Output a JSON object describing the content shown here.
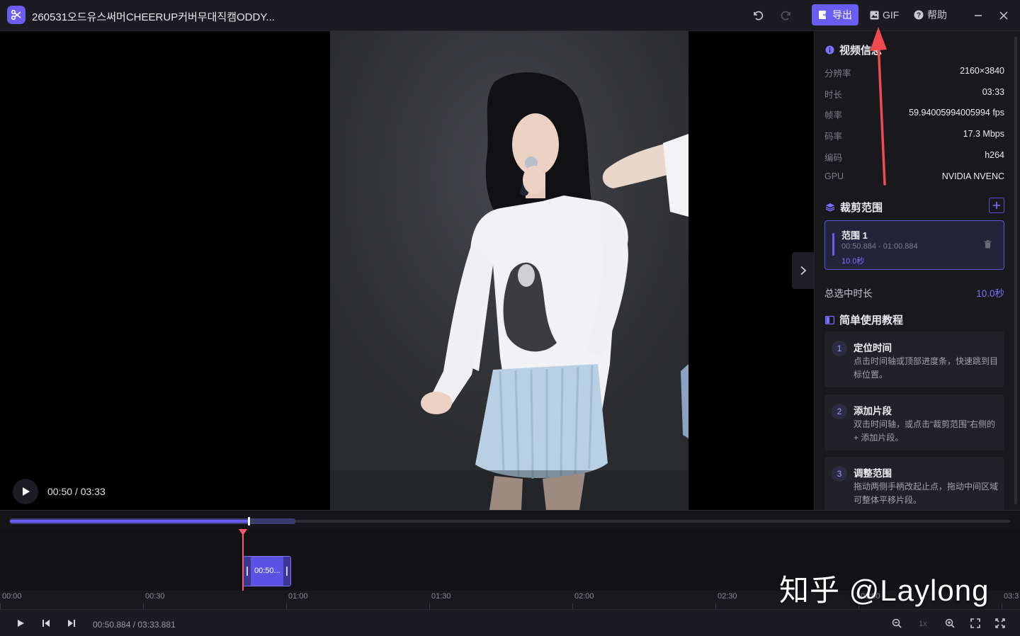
{
  "window": {
    "title": "260531오드유스써머CHEERUP커버무대직캠ODDY..."
  },
  "toolbar": {
    "export_label": "导出",
    "gif_label": "GIF",
    "help_label": "帮助"
  },
  "player": {
    "time_display": "00:50 / 03:33"
  },
  "video_info": {
    "title": "视频信息",
    "rows": [
      {
        "key": "分辨率",
        "value": "2160×3840"
      },
      {
        "key": "时长",
        "value": "03:33"
      },
      {
        "key": "帧率",
        "value": "59.94005994005994 fps"
      },
      {
        "key": "码率",
        "value": "17.3 Mbps"
      },
      {
        "key": "编码",
        "value": "h264"
      },
      {
        "key": "GPU",
        "value": "NVIDIA NVENC"
      }
    ]
  },
  "clip_ranges": {
    "title": "裁剪范围",
    "items": [
      {
        "name": "范围 1",
        "time": "00:50.884 - 01:00.884",
        "duration": "10.0秒"
      }
    ],
    "total_label": "总选中时长",
    "total_value": "10.0秒"
  },
  "tutorial": {
    "title": "简单使用教程",
    "steps": [
      {
        "num": "1",
        "title": "定位时间",
        "desc": "点击时间轴或顶部进度条，快速跳到目标位置。"
      },
      {
        "num": "2",
        "title": "添加片段",
        "desc": "双击时间轴，或点击“裁剪范围”右侧的 + 添加片段。"
      },
      {
        "num": "3",
        "title": "调整范围",
        "desc": "拖动两侧手柄改起止点，拖动中间区域可整体平移片段。"
      }
    ]
  },
  "timeline": {
    "clip_label": "00:50...",
    "ticks": [
      "00:00",
      "00:30",
      "01:00",
      "01:30",
      "02:00",
      "02:30",
      "03:00",
      "03:3"
    ],
    "progress_fraction": 0.2386,
    "range_start_fraction": 0.2386,
    "range_end_fraction": 0.2855
  },
  "bottombar": {
    "time_display": "00:50.884 / 03:33.881",
    "speed_label": "1x"
  },
  "watermark": {
    "text": "知乎 @Laylong"
  },
  "colors": {
    "accent": "#6a5df2",
    "playhead": "#ff5a6e",
    "background": "#141418"
  }
}
